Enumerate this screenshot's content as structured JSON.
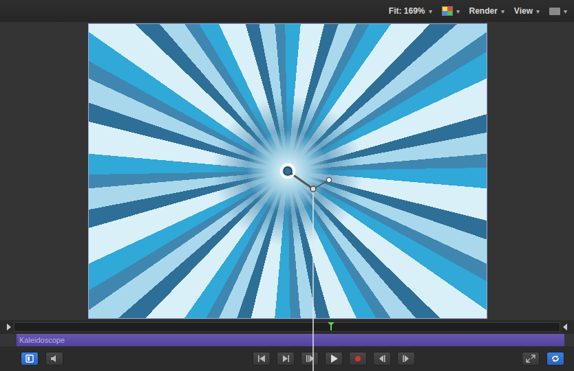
{
  "toolbar": {
    "fit": "Fit: 169%",
    "arrow": "▾",
    "render": "Render",
    "view": "View"
  },
  "timeline": {
    "playhead": 0.58,
    "clip": "Kaleidoscope"
  },
  "transport": {
    "left": [
      {
        "kind": "layers",
        "on": true
      },
      {
        "kind": "audio",
        "on": false
      }
    ],
    "center": [
      {
        "kind": "start",
        "on": false
      },
      {
        "kind": "prev",
        "on": false
      },
      {
        "kind": "next",
        "on": false
      },
      {
        "kind": "play",
        "on": false
      },
      {
        "kind": "record",
        "on": false
      },
      {
        "kind": "back",
        "on": false
      },
      {
        "kind": "forward",
        "on": false
      }
    ],
    "right": [
      {
        "kind": "fullscreen",
        "on": false
      },
      {
        "kind": "loop",
        "on": true
      }
    ]
  }
}
